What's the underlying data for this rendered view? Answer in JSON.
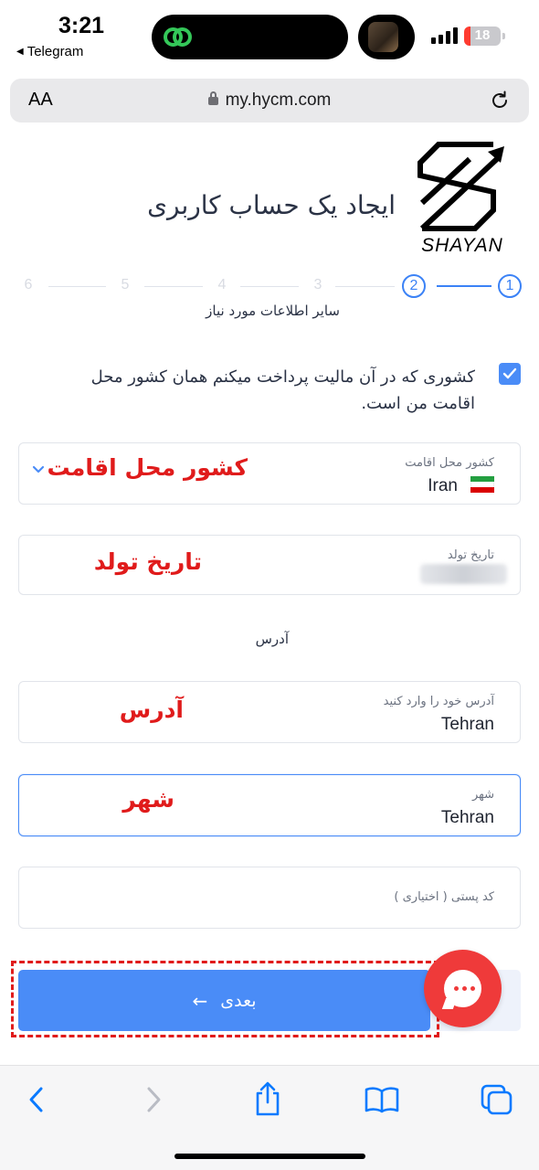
{
  "status_bar": {
    "time": "3:21",
    "back_app": "Telegram",
    "battery": "18",
    "signal_bars": 4
  },
  "browser": {
    "text_size_label": "AA",
    "url": "my.hycm.com"
  },
  "brand": {
    "logo_text": "SHAYAN"
  },
  "page": {
    "title": "ایجاد یک حساب کاربری",
    "stepper": {
      "steps": [
        "1",
        "2",
        "3",
        "4",
        "5",
        "6"
      ],
      "active_step": 2,
      "caption": "سایر اطلاعات مورد نیاز"
    },
    "tax_checkbox": {
      "checked": true,
      "label": "کشوری که در آن مالیت پرداخت میکنم همان کشور محل اقامت من است."
    },
    "country_field": {
      "label": "کشور محل اقامت",
      "value": "Iran",
      "annotation": "کشور محل اقامت",
      "flag_colors": [
        "#239f40",
        "#ffffff",
        "#da0000"
      ]
    },
    "birthdate_field": {
      "label": "تاریخ تولد",
      "annotation": "تاریخ تولد"
    },
    "address_section_label": "آدرس",
    "address_field": {
      "label": "آدرس خود را وارد کنید",
      "value": "Tehran",
      "annotation": "آدرس"
    },
    "city_field": {
      "label": "شهر",
      "value": "Tehran",
      "annotation": "شهر"
    },
    "postal_field": {
      "label": "کد پستی ( اختیاری )"
    },
    "next_button": {
      "label": "بعدی",
      "arrow": "←"
    }
  },
  "colors": {
    "accent": "#4a8cf7",
    "annotation_red": "#e01b1b",
    "chat_fab": "#ef3a3a"
  },
  "toolbar_icons": [
    "back-icon",
    "forward-icon",
    "share-icon",
    "bookmarks-icon",
    "tabs-icon"
  ]
}
